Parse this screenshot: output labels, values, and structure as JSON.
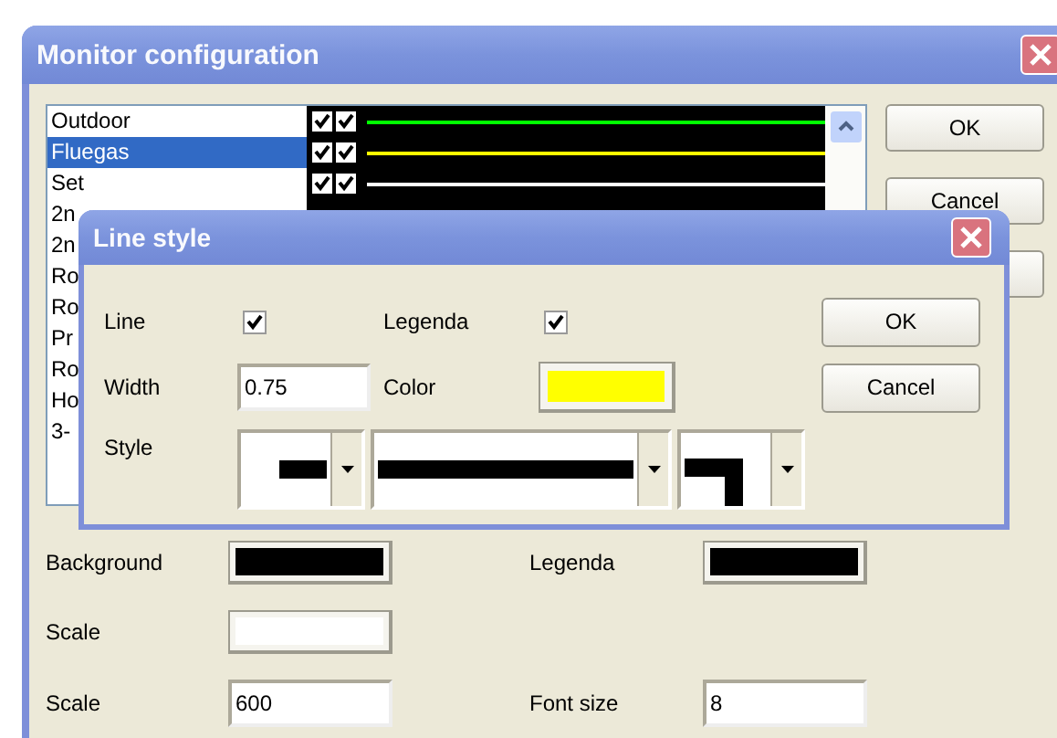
{
  "main_window": {
    "title": "Monitor configuration",
    "channels": [
      {
        "name": "Outdoor",
        "selected": false,
        "line": true,
        "legend": true,
        "color": "#00ff00"
      },
      {
        "name": "Fluegas",
        "selected": true,
        "line": true,
        "legend": true,
        "color": "#ffff00"
      },
      {
        "name": "Set",
        "selected": false,
        "line": true,
        "legend": true,
        "color": "#ffffff"
      },
      {
        "name": "2n",
        "selected": false
      },
      {
        "name": "2n",
        "selected": false
      },
      {
        "name": "Ro",
        "selected": false
      },
      {
        "name": "Ro",
        "selected": false
      },
      {
        "name": "Pr",
        "selected": false
      },
      {
        "name": "Ro",
        "selected": false
      },
      {
        "name": "Ho",
        "selected": false
      },
      {
        "name": "3-",
        "selected": false
      }
    ],
    "buttons": [
      "OK",
      "Cancel"
    ],
    "settings": [
      {
        "kind": "color",
        "label": "Background",
        "color": "#000000"
      },
      {
        "kind": "color",
        "label": "Legenda",
        "color": "#000000"
      },
      {
        "kind": "color",
        "label": "Scale",
        "color": "#ffffff"
      },
      {
        "kind": "blank"
      },
      {
        "kind": "field",
        "label": "Scale",
        "value": "600"
      },
      {
        "kind": "field",
        "label": "Font size",
        "value": "8"
      }
    ]
  },
  "line_style_dialog": {
    "title": "Line style",
    "line": {
      "label": "Line",
      "checked": true
    },
    "legenda": {
      "label": "Legenda",
      "checked": true
    },
    "width": {
      "label": "Width",
      "value": "0.75"
    },
    "color": {
      "label": "Color",
      "color": "#ffff00"
    },
    "style": {
      "label": "Style",
      "pickers": [
        {
          "kind": "dash"
        },
        {
          "kind": "solid"
        },
        {
          "kind": "join"
        }
      ]
    },
    "buttons": [
      "OK",
      "Cancel"
    ]
  }
}
